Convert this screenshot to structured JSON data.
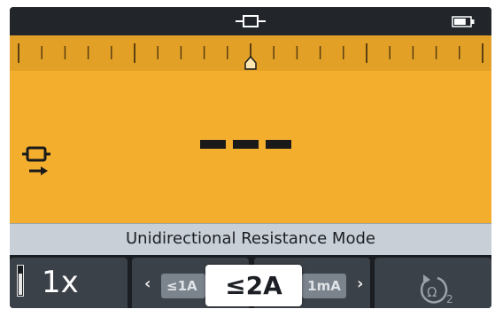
{
  "status_bar": {
    "center_icon": "lead-connector-icon",
    "right_icon": "battery-icon",
    "battery_level": 0.75
  },
  "display": {
    "background_color": "#f3ae2e",
    "ruler_marker_fraction": 0.5,
    "measurement_icon": "unidirectional-resistance-icon",
    "reading": "---"
  },
  "mode": {
    "title": "Unidirectional Resistance Mode"
  },
  "softkeys": {
    "zoom": {
      "label": "1x"
    },
    "current_selector": {
      "prev_option": "≤1A",
      "selected": "≤2A",
      "next_option": "1mA"
    },
    "reset": {
      "icon": "reset-ohm-icon",
      "subscript": "2"
    }
  }
}
